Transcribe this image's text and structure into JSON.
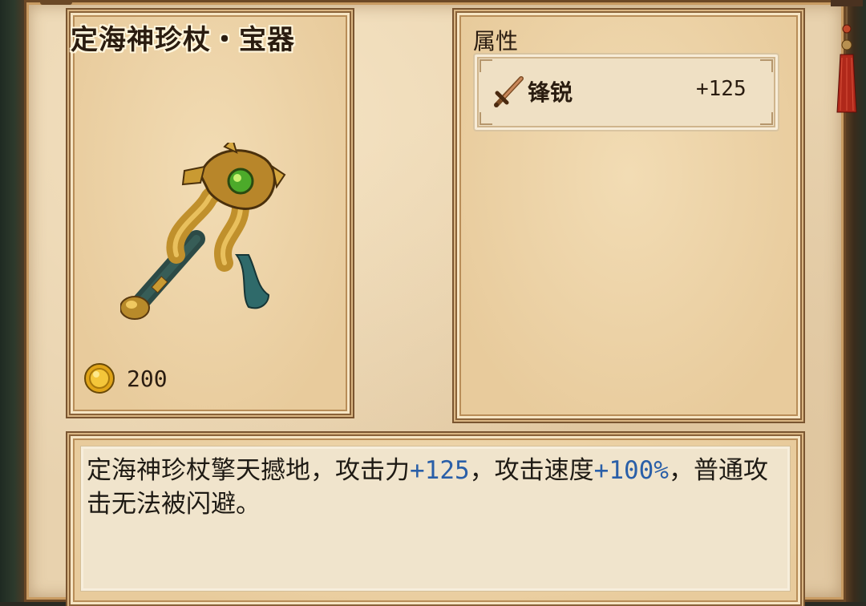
{
  "item": {
    "title": "定海神珍杖・宝器",
    "price": "200",
    "icon": "dragon-scepter"
  },
  "attributes": {
    "header": "属性",
    "rows": [
      {
        "icon": "sword-icon",
        "name": "锋锐",
        "value": "+125"
      }
    ]
  },
  "description": {
    "part1": "定海神珍杖擎天撼地，攻击力",
    "val1": "+125",
    "part2": "，攻击速度",
    "val2": "+100%",
    "part3": "，普通攻击无法被闪避。"
  },
  "colors": {
    "parchment": "#e8d2ae",
    "frame": "#8a6238",
    "highlight_value": "#2a5fa8",
    "text": "#2a1c10"
  }
}
